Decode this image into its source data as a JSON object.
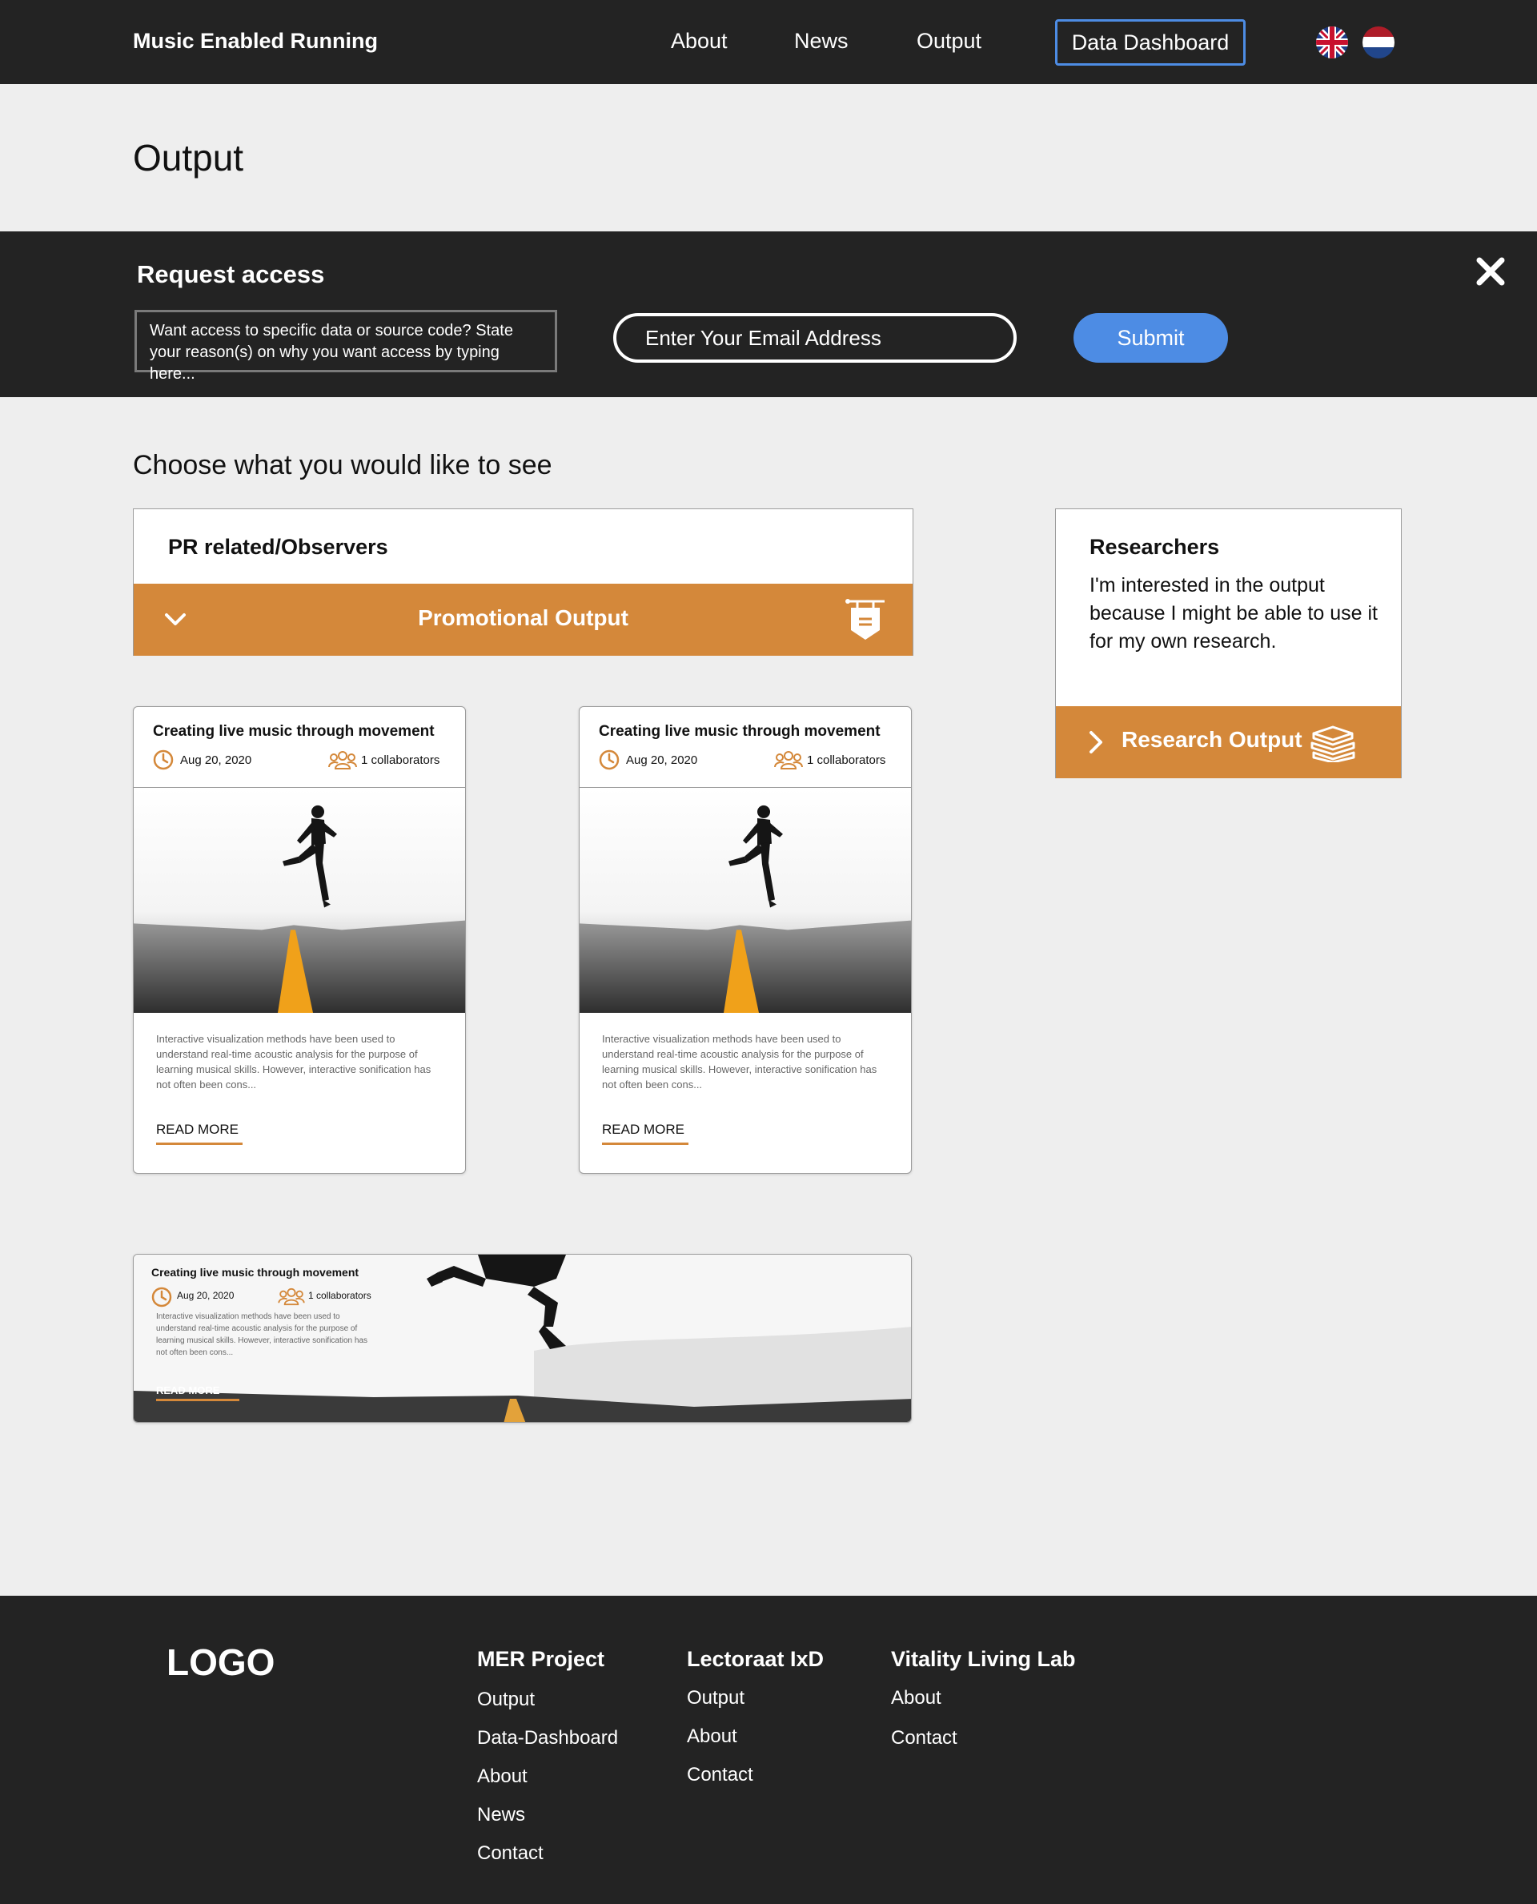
{
  "header": {
    "brand": "Music Enabled Running",
    "nav": [
      "About",
      "News",
      "Output"
    ],
    "dashboard": "Data Dashboard",
    "languages": [
      "English",
      "Dutch"
    ]
  },
  "page": {
    "title": "Output"
  },
  "request_access": {
    "title": "Request access",
    "reason_placeholder": "Want access to specific data or source code? State your reason(s) on why you want access by typing here...",
    "email_placeholder": "Enter Your Email Address",
    "submit": "Submit"
  },
  "choose": {
    "heading": "Choose what you would like to see",
    "pr_card": {
      "title": "PR related/Observers",
      "bar_label": "Promotional Output",
      "icon": "signboard-icon"
    },
    "research_card": {
      "title": "Researchers",
      "description": "I'm interested in the output because I might be able to use it for my own research.",
      "bar_label": "Research Output",
      "icon": "books-icon"
    }
  },
  "posts": [
    {
      "title": "Creating live music through movement",
      "date": "Aug 20, 2020",
      "collaborators": "1 collaborators",
      "excerpt": "Interactive visualization methods have been used to understand real-time acoustic analysis for the purpose of learning musical skills. However, interactive sonification has not often been cons...",
      "read_more": "READ MORE"
    },
    {
      "title": "Creating live music through movement",
      "date": "Aug 20, 2020",
      "collaborators": "1 collaborators",
      "excerpt": "Interactive visualization methods have been used to understand real-time acoustic analysis for the purpose of learning musical skills. However, interactive sonification has not often been cons...",
      "read_more": "READ MORE"
    },
    {
      "title": "Creating live music through movement",
      "date": "Aug 20, 2020",
      "collaborators": "1 collaborators",
      "excerpt": "Interactive visualization methods have been used to understand real-time acoustic analysis for the purpose of learning musical skills. However, interactive sonification has not often been cons...",
      "read_more": "READ MORE"
    }
  ],
  "footer": {
    "logo": "LOGO",
    "columns": [
      {
        "title": "MER Project",
        "links": [
          "Output",
          "Data-Dashboard",
          "About",
          "News",
          "Contact"
        ]
      },
      {
        "title": "Lectoraat IxD",
        "links": [
          "Output",
          "About",
          "Contact"
        ]
      },
      {
        "title": "Vitality Living Lab",
        "links": [
          "About",
          "Contact"
        ]
      }
    ]
  },
  "colors": {
    "accent": "#d4883a",
    "primary": "#4d8ce4",
    "dark": "#232323",
    "background": "#eeeeee"
  }
}
